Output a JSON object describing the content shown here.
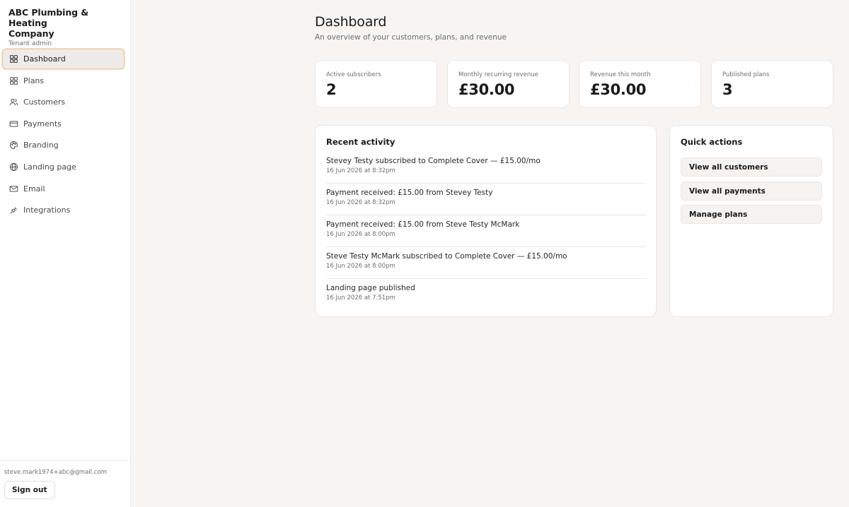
{
  "brand": {
    "name_line1": "ABC Plumbing & Heating",
    "name_line2": "Company",
    "role": "Tenant admin"
  },
  "nav": [
    {
      "label": "Dashboard",
      "icon": "grid-icon",
      "active": true
    },
    {
      "label": "Plans",
      "icon": "grid-icon"
    },
    {
      "label": "Customers",
      "icon": "users-icon"
    },
    {
      "label": "Payments",
      "icon": "credit-card-icon"
    },
    {
      "label": "Branding",
      "icon": "palette-icon"
    },
    {
      "label": "Landing page",
      "icon": "globe-icon"
    },
    {
      "label": "Email",
      "icon": "mail-icon"
    },
    {
      "label": "Integrations",
      "icon": "plug-icon"
    }
  ],
  "footer": {
    "email": "steve.mark1974+abc@gmail.com",
    "sign_out": "Sign out"
  },
  "header": {
    "title": "Dashboard",
    "subtitle": "An overview of your customers, plans, and revenue"
  },
  "stats": [
    {
      "label": "Active subscribers",
      "value": "2"
    },
    {
      "label": "Monthly recurring revenue",
      "value": "£30.00"
    },
    {
      "label": "Revenue this month",
      "value": "£30.00"
    },
    {
      "label": "Published plans",
      "value": "3"
    }
  ],
  "activity": {
    "title": "Recent activity",
    "items": [
      {
        "text": "Stevey Testy subscribed to Complete Cover — £15.00/mo",
        "time": "16 Jun 2026 at 8:32pm"
      },
      {
        "text": "Payment received: £15.00 from Stevey Testy",
        "time": "16 Jun 2026 at 8:32pm"
      },
      {
        "text": "Payment received: £15.00 from Steve Testy McMark",
        "time": "16 Jun 2026 at 8:00pm"
      },
      {
        "text": "Steve Testy McMark subscribed to Complete Cover — £15.00/mo",
        "time": "16 Jun 2026 at 8:00pm"
      },
      {
        "text": "Landing page published",
        "time": "16 Jun 2026 at 7:51pm"
      }
    ]
  },
  "quick_actions": {
    "title": "Quick actions",
    "items": [
      "View all customers",
      "View all payments",
      "Manage plans"
    ]
  }
}
